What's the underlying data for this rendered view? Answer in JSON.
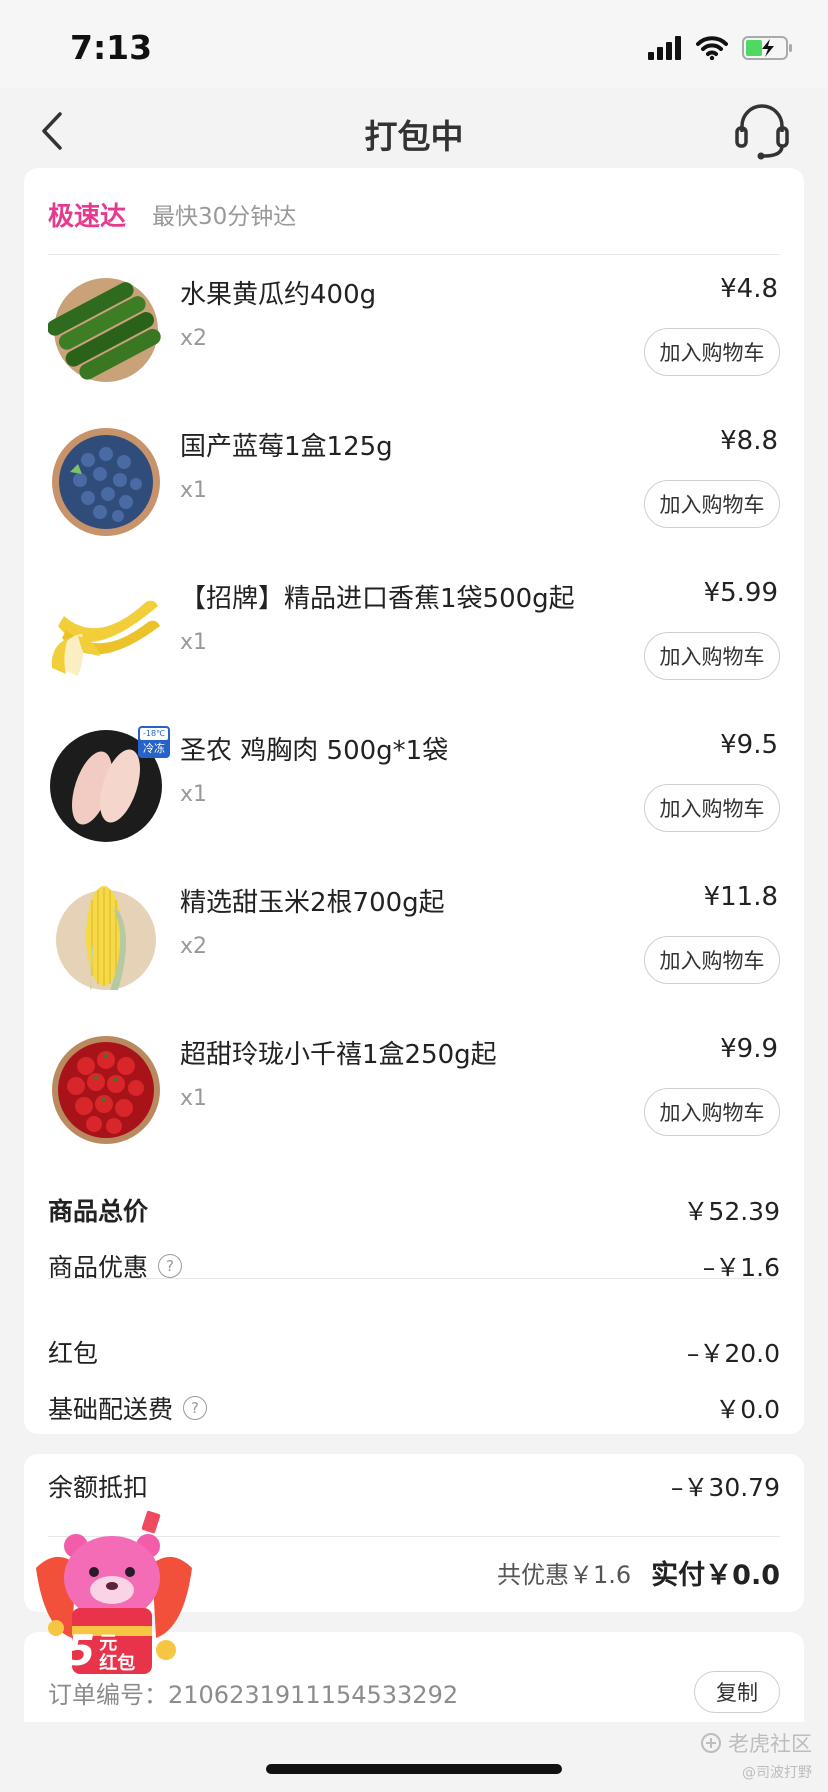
{
  "status_bar": {
    "time": "7:13"
  },
  "navbar": {
    "title": "打包中"
  },
  "delivery": {
    "label": "极速达",
    "desc": "最快30分钟达"
  },
  "items": [
    {
      "name": "水果黄瓜约400g",
      "qty": "x2",
      "price": "¥4.8",
      "button": "加入购物车",
      "image": "cucumber"
    },
    {
      "name": "国产蓝莓1盒125g",
      "qty": "x1",
      "price": "¥8.8",
      "button": "加入购物车",
      "image": "blueberry"
    },
    {
      "name": "【招牌】精品进口香蕉1袋500g起",
      "qty": "x1",
      "price": "¥5.99",
      "button": "加入购物车",
      "image": "banana"
    },
    {
      "name": "圣农 鸡胸肉 500g*1袋",
      "qty": "x1",
      "price": "¥9.5",
      "button": "加入购物车",
      "image": "chicken-breast",
      "badge_top": "-18℃",
      "badge_bottom": "冷冻"
    },
    {
      "name": "精选甜玉米2根700g起",
      "qty": "x2",
      "price": "¥11.8",
      "button": "加入购物车",
      "image": "corn"
    },
    {
      "name": "超甜玲珑小千禧1盒250g起",
      "qty": "x1",
      "price": "¥9.9",
      "button": "加入购物车",
      "image": "cherry-tomato"
    }
  ],
  "summary": {
    "subtotal_label": "商品总价",
    "subtotal_value": "￥52.39",
    "discount_label": "商品优惠",
    "discount_value": "–￥1.6",
    "redpacket_label": "红包",
    "redpacket_value": "–￥20.0",
    "delivery_fee_label": "基础配送费",
    "delivery_fee_value": "￥0.0",
    "help_symbol": "?"
  },
  "payment": {
    "balance_label": "余额抵扣",
    "balance_value": "–￥30.79",
    "total_discount": "共优惠￥1.6",
    "paid": "实付￥0.0"
  },
  "order": {
    "number_text": "订单编号：2106231911154533292",
    "copy_label": "复制"
  },
  "promo": {
    "amount": "5",
    "unit": "元",
    "text": "红包"
  },
  "watermark": {
    "main": "老虎社区",
    "sub": "@司波打野"
  },
  "colors": {
    "accent": "#e53a8d",
    "muted": "#999999"
  }
}
